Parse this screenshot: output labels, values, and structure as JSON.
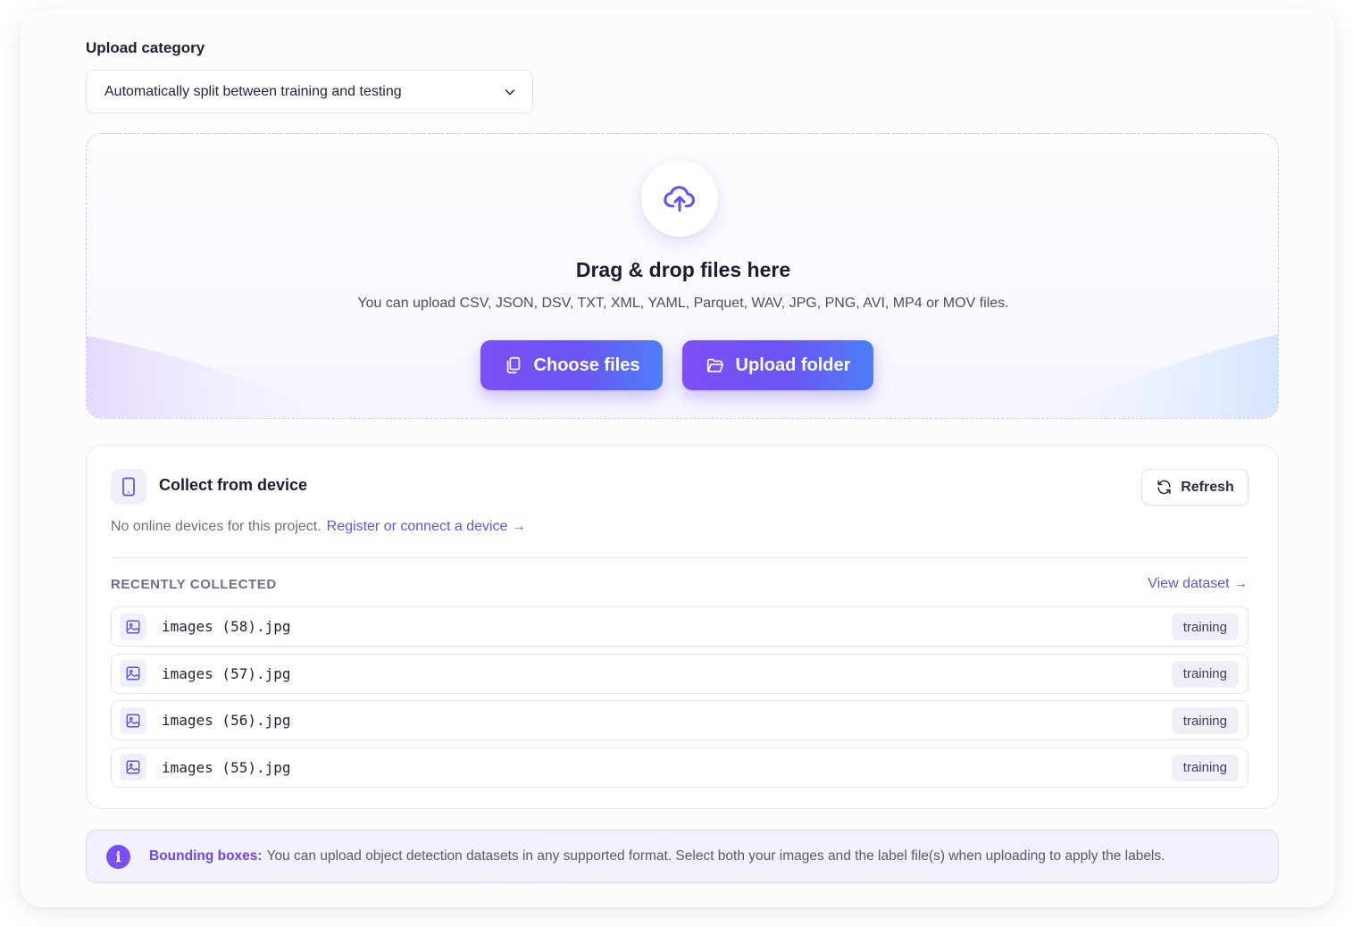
{
  "upload_category": {
    "label": "Upload category",
    "selected": "Automatically split between training and testing"
  },
  "dropzone": {
    "title": "Drag & drop files here",
    "subtitle": "You can upload CSV, JSON, DSV, TXT, XML, YAML, Parquet, WAV, JPG, PNG, AVI, MP4 or MOV files.",
    "choose_files_label": "Choose files",
    "upload_folder_label": "Upload folder"
  },
  "device": {
    "title": "Collect from device",
    "refresh_label": "Refresh",
    "status_text": "No online devices for this project.",
    "register_link": "Register or connect a device →",
    "recent_heading": "RECENTLY COLLECTED",
    "view_dataset_link": "View dataset →",
    "files": [
      {
        "name": "images (58).jpg",
        "tag": "training"
      },
      {
        "name": "images (57).jpg",
        "tag": "training"
      },
      {
        "name": "images (56).jpg",
        "tag": "training"
      },
      {
        "name": "images (55).jpg",
        "tag": "training"
      }
    ]
  },
  "info": {
    "icon_text": "i",
    "strong": "Bounding boxes:",
    "text": "You can upload object detection datasets in any supported format. Select both your images and the label file(s) when uploading to apply the labels."
  },
  "colors": {
    "accent": "#6a4ff0",
    "button_gradient_start": "#7d4ff5",
    "button_gradient_end": "#4e7ef8"
  },
  "icons": [
    "chevron-down-icon",
    "cloud-upload-icon",
    "files-icon",
    "folder-icon",
    "phone-icon",
    "refresh-icon",
    "image-icon",
    "info-icon"
  ]
}
